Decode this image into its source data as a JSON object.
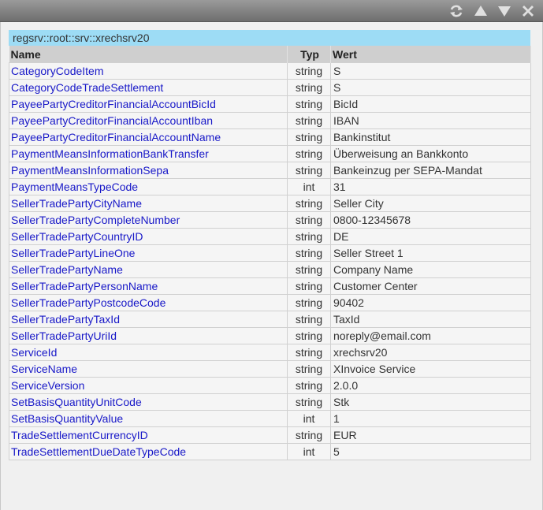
{
  "path": "regsrv::root::srv::xrechsrv20",
  "columns": {
    "name": "Name",
    "typ": "Typ",
    "wert": "Wert"
  },
  "rows": [
    {
      "name": "CategoryCodeItem",
      "typ": "string",
      "wert": "S"
    },
    {
      "name": "CategoryCodeTradeSettlement",
      "typ": "string",
      "wert": "S"
    },
    {
      "name": "PayeePartyCreditorFinancialAccountBicId",
      "typ": "string",
      "wert": "BicId"
    },
    {
      "name": "PayeePartyCreditorFinancialAccountIban",
      "typ": "string",
      "wert": "IBAN"
    },
    {
      "name": "PayeePartyCreditorFinancialAccountName",
      "typ": "string",
      "wert": "Bankinstitut"
    },
    {
      "name": "PaymentMeansInformationBankTransfer",
      "typ": "string",
      "wert": "Überweisung an Bankkonto"
    },
    {
      "name": "PaymentMeansInformationSepa",
      "typ": "string",
      "wert": "Bankeinzug per SEPA-Mandat"
    },
    {
      "name": "PaymentMeansTypeCode",
      "typ": "int",
      "wert": "31"
    },
    {
      "name": "SellerTradePartyCityName",
      "typ": "string",
      "wert": "Seller City"
    },
    {
      "name": "SellerTradePartyCompleteNumber",
      "typ": "string",
      "wert": "0800-12345678"
    },
    {
      "name": "SellerTradePartyCountryID",
      "typ": "string",
      "wert": "DE"
    },
    {
      "name": "SellerTradePartyLineOne",
      "typ": "string",
      "wert": "Seller Street 1"
    },
    {
      "name": "SellerTradePartyName",
      "typ": "string",
      "wert": "Company Name"
    },
    {
      "name": "SellerTradePartyPersonName",
      "typ": "string",
      "wert": "Customer Center"
    },
    {
      "name": "SellerTradePartyPostcodeCode",
      "typ": "string",
      "wert": "90402"
    },
    {
      "name": "SellerTradePartyTaxId",
      "typ": "string",
      "wert": "TaxId"
    },
    {
      "name": "SellerTradePartyUriId",
      "typ": "string",
      "wert": "noreply@email.com"
    },
    {
      "name": "ServiceId",
      "typ": "string",
      "wert": "xrechsrv20"
    },
    {
      "name": "ServiceName",
      "typ": "string",
      "wert": "XInvoice Service"
    },
    {
      "name": "ServiceVersion",
      "typ": "string",
      "wert": "2.0.0"
    },
    {
      "name": "SetBasisQuantityUnitCode",
      "typ": "string",
      "wert": "Stk"
    },
    {
      "name": "SetBasisQuantityValue",
      "typ": "int",
      "wert": "1"
    },
    {
      "name": "TradeSettlementCurrencyID",
      "typ": "string",
      "wert": "EUR"
    },
    {
      "name": "TradeSettlementDueDateTypeCode",
      "typ": "int",
      "wert": "5"
    }
  ],
  "toolbar_icons": [
    "refresh-icon",
    "arrow-up-icon",
    "arrow-down-icon",
    "close-icon"
  ],
  "colors": {
    "path_bar": "#9ddcf5",
    "link": "#1818c8",
    "header": "#cfcfcf"
  }
}
